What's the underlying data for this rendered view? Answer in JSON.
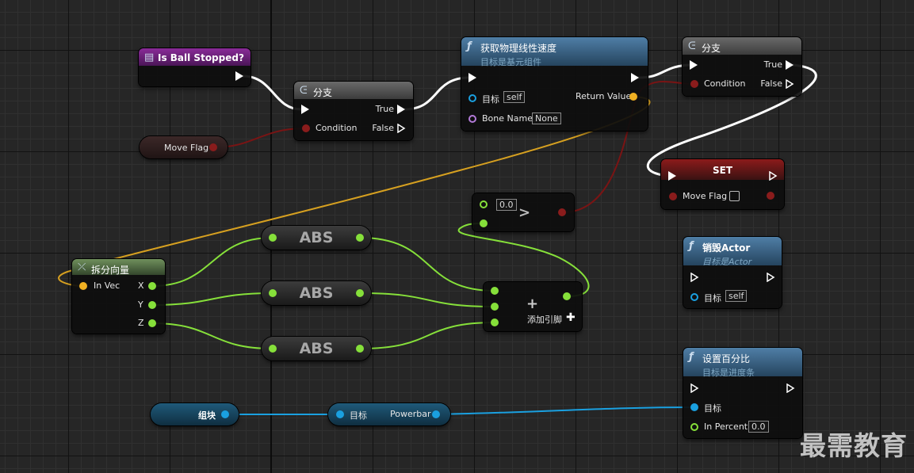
{
  "nodes": {
    "is_ball_stopped": {
      "title": "Is Ball Stopped?"
    },
    "branch1": {
      "title": "分支",
      "pin_condition": "Condition",
      "pin_true": "True",
      "pin_false": "False"
    },
    "move_flag_get": {
      "label": "Move Flag"
    },
    "get_velocity": {
      "title": "获取物理线性速度",
      "subtitle": "目标是基元组件",
      "pin_target": "目标",
      "target_value": "self",
      "pin_bone": "Bone Name",
      "bone_value": "None",
      "pin_return": "Return Value"
    },
    "branch2": {
      "title": "分支",
      "pin_condition": "Condition",
      "pin_true": "True",
      "pin_false": "False"
    },
    "set_node": {
      "title": "SET",
      "pin_move_flag": "Move Flag"
    },
    "greater": {
      "value": "0.0",
      "op": ">"
    },
    "break_vector": {
      "title": "拆分向量",
      "pin_in": "In Vec",
      "pin_x": "X",
      "pin_y": "Y",
      "pin_z": "Z"
    },
    "abs_nodes": [
      {
        "label": "ABS"
      },
      {
        "label": "ABS"
      },
      {
        "label": "ABS"
      }
    ],
    "add_node": {
      "plus": "+",
      "add_pin": "添加引脚"
    },
    "destroy_actor": {
      "title": "销毁Actor",
      "subtitle": "目标是Actor",
      "pin_target": "目标",
      "target_value": "self"
    },
    "set_percent": {
      "title": "设置百分比",
      "subtitle": "目标是进度条",
      "pin_target": "目标",
      "pin_percent": "In Percent",
      "percent_value": "0.0"
    },
    "ui_var": {
      "label": "组块"
    },
    "powerbar_get": {
      "pin_target": "目标",
      "label": "Powerbar"
    }
  },
  "watermark": "最需教育",
  "colors": {
    "exec": "#ffffff",
    "bool": "#8a1c1c",
    "vector": "#f0b022",
    "float": "#86e03a",
    "object": "#1aa0e0",
    "name": "#b27ad8"
  }
}
